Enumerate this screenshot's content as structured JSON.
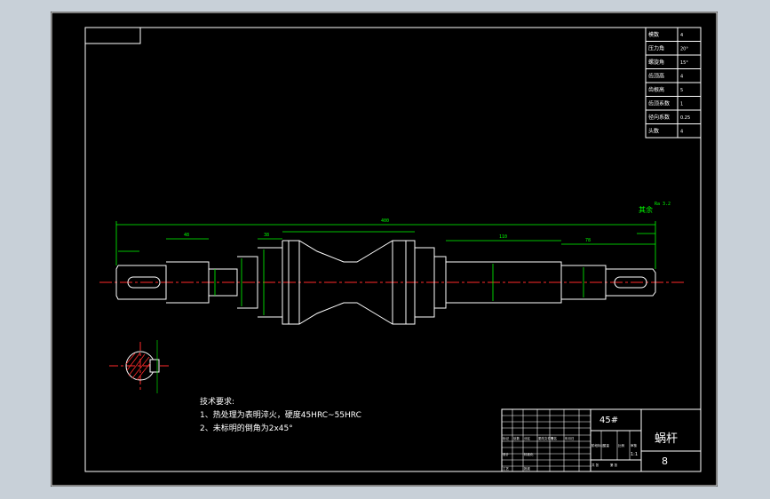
{
  "params_table": [
    {
      "label": "模数",
      "value": "4"
    },
    {
      "label": "压力角",
      "value": "20°"
    },
    {
      "label": "螺旋角",
      "value": "15°"
    },
    {
      "label": "齿顶高",
      "value": "4"
    },
    {
      "label": "齿根高",
      "value": "5"
    },
    {
      "label": "齿顶系数",
      "value": "1"
    },
    {
      "label": "径向系数",
      "value": "0.25"
    },
    {
      "label": "头数",
      "value": "4"
    }
  ],
  "tech_requirements": {
    "heading": "技术要求:",
    "items": [
      "1、热处理为表明淬火，硬度45HRC~55HRC",
      "2、未标明的倒角为2x45°"
    ]
  },
  "title_block": {
    "material": "45#",
    "part_name": "蜗杆",
    "drawing_number": "8",
    "scale": "1:1",
    "small_cells": [
      "标记",
      "处数",
      "分区",
      "更改文件号",
      "签名",
      "年月日",
      "设计",
      "标准化",
      "阶段标记",
      "重量",
      "比例",
      "审核",
      "工艺",
      "批准",
      "共 张",
      "第 张"
    ]
  },
  "dimensions": {
    "overall_length": "400",
    "section_a": "48",
    "section_b": "38",
    "section_c": "110",
    "section_d": "78"
  },
  "annotations": {
    "roughness_mark": "Ra 3.2",
    "surface_note": "其余"
  }
}
